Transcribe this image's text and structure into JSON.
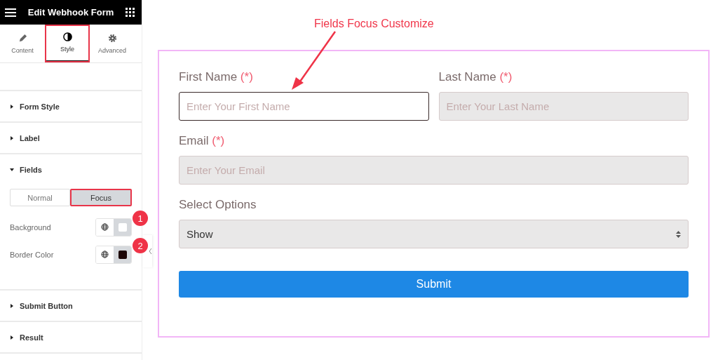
{
  "header": {
    "title": "Edit Webhook Form"
  },
  "tabs": [
    {
      "label": "Content",
      "kind": "pencil",
      "selected": false
    },
    {
      "label": "Style",
      "kind": "contrast",
      "selected": true
    },
    {
      "label": "Advanced",
      "kind": "gear",
      "selected": false
    }
  ],
  "sections": [
    {
      "label": "Form Style",
      "expanded": false
    },
    {
      "label": "Label",
      "expanded": false
    },
    {
      "label": "Fields",
      "expanded": true,
      "states": [
        {
          "label": "Normal",
          "selected": false
        },
        {
          "label": "Focus",
          "selected": true
        }
      ],
      "controls": [
        {
          "label": "Background",
          "color": "#ffffff",
          "badge": "1"
        },
        {
          "label": "Border Color",
          "color": "#1c0505",
          "badge": "2"
        }
      ]
    },
    {
      "label": "Submit Button",
      "expanded": false
    },
    {
      "label": "Result",
      "expanded": false
    }
  ],
  "annotation": "Fields Focus Customize",
  "form": {
    "rows": [
      [
        {
          "label": "First Name",
          "required": "(*)",
          "placeholder": "Enter Your First Name",
          "focused": true
        },
        {
          "label": "Last Name",
          "required": "(*)",
          "placeholder": "Enter Your Last Name",
          "focused": false
        }
      ],
      [
        {
          "label": "Email",
          "required": "(*)",
          "placeholder": "Enter Your Email",
          "focused": false
        }
      ]
    ],
    "select": {
      "label": "Select Options",
      "value": "Show"
    },
    "submit": "Submit"
  }
}
